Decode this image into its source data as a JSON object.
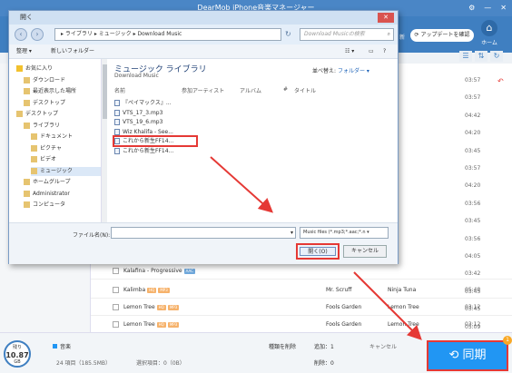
{
  "app": {
    "title": "DearMob iPhone音楽マネージャー",
    "update_button": "アップデートを確認",
    "home_label": "ホーム",
    "toolbar_clip_text": "新"
  },
  "tracks": [
    {
      "title": "Kalafina - Progressive",
      "badges": [
        "AAC"
      ],
      "artist": "",
      "album": "",
      "duration": ""
    },
    {
      "title": "Kalimba",
      "badges": [
        "HQ",
        "MP3"
      ],
      "artist": "Mr. Scruff",
      "album": "Ninja Tuna",
      "duration": "05:48"
    },
    {
      "title": "Lemon Tree",
      "badges": [
        "HQ",
        "MP3"
      ],
      "artist": "Fools Garden",
      "album": "Lemon Tree",
      "duration": "03:12"
    },
    {
      "title": "Lemon Tree",
      "badges": [
        "HQ",
        "MP3"
      ],
      "artist": "Fools Garden",
      "album": "Lemon Tree",
      "duration": "03:12"
    }
  ],
  "durations": [
    "03:57",
    "03:57",
    "04:42",
    "04:20",
    "03:45",
    "03:57",
    "04:20",
    "03:56",
    "03:45",
    "03:56",
    "04:05",
    "03:42",
    "03:45",
    "03:45",
    "05:09"
  ],
  "bottom": {
    "storage_label": "残り",
    "storage_value": "10.87",
    "storage_unit": "GB",
    "music_label": "音楽",
    "summary": "24 項目（185.5MB）",
    "selected": "選択項目：0（0B）",
    "types_label": "種類を削除",
    "added_label": "追加：1",
    "removed_label": "削除：0",
    "cancel_label": "キャンセル",
    "sync_label": "同期",
    "sync_badge": "1"
  },
  "dialog": {
    "title": "開く",
    "address": {
      "root": "ライブラリ",
      "music": "ミュージック",
      "folder": "Download Music"
    },
    "search_placeholder": "Download Musicの検索",
    "cmd_organize": "整理 ▾",
    "cmd_new_folder": "新しいフォルダー",
    "tree": [
      {
        "label": "お気に入り",
        "level": 0,
        "icon": "star-icon"
      },
      {
        "label": "ダウンロード",
        "level": 1,
        "icon": "download-folder-icon"
      },
      {
        "label": "最近表示した場所",
        "level": 1,
        "icon": "recent-places-icon"
      },
      {
        "label": "デスクトップ",
        "level": 1,
        "icon": "desktop-icon"
      },
      {
        "label": "デスクトップ",
        "level": 0,
        "icon": "desktop-icon"
      },
      {
        "label": "ライブラリ",
        "level": 1,
        "icon": "library-icon"
      },
      {
        "label": "ドキュメント",
        "level": 2,
        "icon": "documents-icon"
      },
      {
        "label": "ピクチャ",
        "level": 2,
        "icon": "pictures-icon"
      },
      {
        "label": "ビデオ",
        "level": 2,
        "icon": "videos-icon"
      },
      {
        "label": "ミュージック",
        "level": 2,
        "icon": "music-icon"
      },
      {
        "label": "ホームグループ",
        "level": 1,
        "icon": "homegroup-icon"
      },
      {
        "label": "Administrator",
        "level": 1,
        "icon": "user-icon"
      },
      {
        "label": "コンピュータ",
        "level": 1,
        "icon": "computer-icon"
      }
    ],
    "library_title": "ミュージック ライブラリ",
    "library_sub": "Download Music",
    "arrange_label": "並べ替え:",
    "arrange_value": "フォルダー ▾",
    "columns": [
      "名前",
      "参加アーティスト",
      "アルバム",
      "#",
      "タイトル"
    ],
    "files": [
      "『ペイマックス』...",
      "VTS_17_3.mp3",
      "VTS_19_6.mp3",
      "Wiz Khalifa - See...",
      "これから新生FF14...",
      "これから新生FF14..."
    ],
    "filename_label": "ファイル名(N):",
    "filter_value": "Music files (*.mp3;*.aac;*.n ▾",
    "open_label": "開く(O)",
    "cancel_label": "キャンセル"
  },
  "colors": {
    "accent": "#3f7fc1",
    "highlight": "#e53935",
    "sync_button": "#2196f3"
  }
}
